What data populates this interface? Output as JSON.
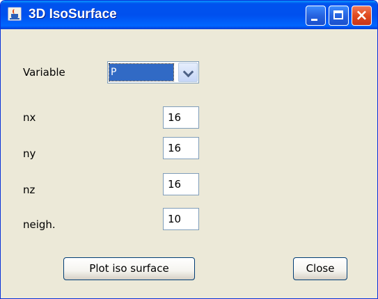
{
  "window": {
    "title": "3D IsoSurface"
  },
  "title_buttons": {
    "minimize": "minimize",
    "maximize": "maximize",
    "close": "close"
  },
  "variable": {
    "label": "Variable",
    "selected": "P"
  },
  "fields": [
    {
      "label": "nx",
      "value": "16"
    },
    {
      "label": "ny",
      "value": "16"
    },
    {
      "label": "nz",
      "value": "16"
    },
    {
      "label": "neigh.",
      "value": "10"
    }
  ],
  "buttons": {
    "plot": "Plot iso surface",
    "close": "Close"
  },
  "icons": {
    "app": "java-coffee-cup-icon",
    "minimize": "minimize-icon",
    "maximize": "maximize-icon",
    "close": "close-icon",
    "dropdown": "chevron-down-icon"
  },
  "colors": {
    "titlebar": "#0050EE",
    "background": "#ECE9D8",
    "selection": "#316AC5",
    "close_button": "#E04A1E"
  }
}
